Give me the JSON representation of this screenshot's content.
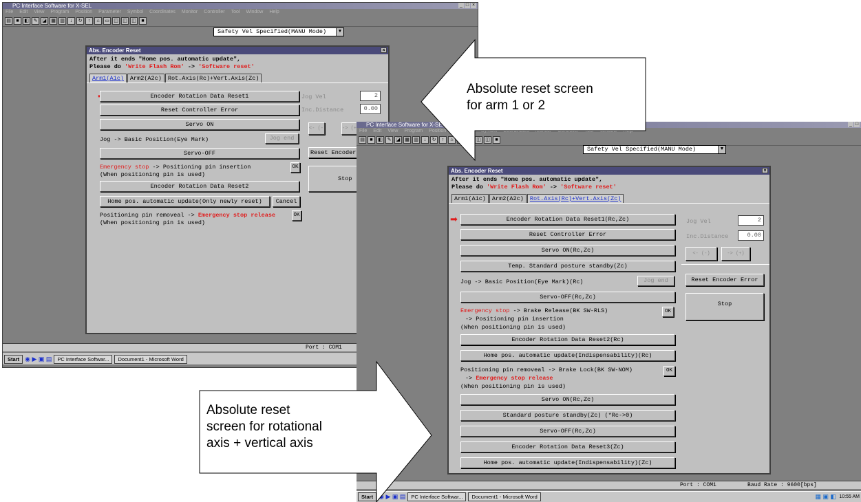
{
  "window1": {
    "title": "PC Interface Software for X-SEL",
    "menu": [
      "File",
      "Edit",
      "View",
      "Program",
      "Position",
      "Parameter",
      "Symbol",
      "Coordinates",
      "Monitor",
      "Controller",
      "Tool",
      "Window",
      "Help"
    ],
    "mode_select": "Safety Vel Specified(MANU Mode)",
    "status_port": "Port : COM1",
    "taskbar": {
      "start": "Start",
      "task1": "PC Interface Softwar...",
      "task2": "Document1 - Microsoft Word"
    }
  },
  "dialog1": {
    "title": "Abs. Encoder Reset",
    "note_line1": "After it ends \"Home pos. automatic update\",",
    "note_line2_prefix": "Please do ",
    "note_line2_red1": "'Write Flash Rom'",
    "note_line2_mid": " -> ",
    "note_line2_red2": "'Software reset'",
    "tabs": [
      "Arm1(A1c)",
      "Arm2(A2c)",
      "Rot.Axis(Rc)+Vert.Axis(Zc)"
    ],
    "enc_reset1": "Encoder Rotation Data Reset1",
    "reset_ctrl_err": "Reset Controller Error",
    "servo_on": "Servo ON",
    "jog_basic": "Jog -> Basic Position(Eye Mark)",
    "jog_end": "Jog end",
    "servo_off": "Servo-OFF",
    "estop_red": "Emergency stop",
    "estop_rest": " -> Positioning pin insertion",
    "when_used": "(When positioning pin is used)",
    "ok": "OK",
    "enc_reset2": "Encoder Rotation Data Reset2",
    "home_update": "Home pos. automatic update(Only newly reset)",
    "cancel": "Cancel",
    "pin_removal": "Positioning pin removeal -> ",
    "estop_release": "Emergency stop release",
    "when_used2": "(When positioning pin is used)",
    "jog_vel_label": "Jog Vel",
    "jog_vel_value": "2",
    "inc_dist_label": "Inc.Distance",
    "inc_dist_value": "0.00",
    "jog_minus": "<- (-)",
    "jog_plus": "-> (+)",
    "reset_encoder_error": "Reset Encoder Error",
    "stop": "Stop"
  },
  "window2": {
    "title": "PC Interface Software for X-SEL",
    "menu": [
      "File",
      "Edit",
      "View",
      "Program",
      "Position",
      "Parameter",
      "Symbol",
      "Coordinates",
      "Monitor",
      "Controller",
      "Tool",
      "Window",
      "Help"
    ],
    "mode_select": "Safety Vel Specified(MANU Mode)",
    "status_port": "Port : COM1",
    "status_baud": "Baud Rate : 9600[bps]",
    "taskbar": {
      "start": "Start",
      "task1": "PC Interface Softwar...",
      "task2": "Document1 - Microsoft Word",
      "clock": "10:55 AM"
    }
  },
  "dialog2": {
    "title": "Abs. Encoder Reset",
    "note_line1": "After it ends \"Home pos. automatic update\",",
    "note_line2_prefix": "Please do ",
    "note_line2_red1": "'Write Flash Rom'",
    "note_line2_mid": " -> ",
    "note_line2_red2": "'Software reset'",
    "tabs": [
      "Arm1(A1c)",
      "Arm2(A2c)",
      "Rot.Axis(Rc)+Vert.Axis(Zc)"
    ],
    "enc_reset1": "Encoder Rotation Data Reset1(Rc,Zc)",
    "reset_ctrl_err": "Reset Controller Error",
    "servo_on": "Servo ON(Rc,Zc)",
    "temp_standby": "Temp. Standard posture standby(Zc)",
    "jog_basic": "Jog -> Basic Position(Eye Mark)(Rc)",
    "jog_end": "Jog end",
    "servo_off": "Servo-OFF(Rc,Zc)",
    "estop_red": "Emergency stop",
    "estop_rest": " -> Brake Release(BK SW-RLS)",
    "pin_insert": "-> Positioning pin insertion",
    "when_used": "(When positioning pin is used)",
    "ok": "OK",
    "enc_reset2": "Encoder Rotation Data Reset2(Rc)",
    "home_update": "Home pos. automatic update(Indispensability)(Rc)",
    "pin_removal": "Positioning pin removeal -> Brake Lock(BK SW-NOM)",
    "estop_release_prefix": "-> ",
    "estop_release": "Emergency stop release",
    "when_used2": "(When positioning pin is used)",
    "servo_on2": "Servo ON(Rc,Zc)",
    "std_standby": "Standard posture standby(Zc)  (*Rc->0)",
    "servo_off2": "Servo-OFF(Rc,Zc)",
    "enc_reset3": "Encoder Rotation Data Reset3(Zc)",
    "home_update2": "Home pos. automatic update(Indispensability)(Zc)",
    "jog_vel_label": "Jog Vel",
    "jog_vel_value": "2",
    "inc_dist_label": "Inc.Distance",
    "inc_dist_value": "0.00",
    "jog_minus": "<- (-)",
    "jog_plus": "-> (+)",
    "reset_encoder_error": "Reset Encoder Error",
    "stop": "Stop"
  },
  "callouts": {
    "arm": [
      "Absolute reset screen",
      "for arm 1 or 2"
    ],
    "rot": [
      "Absolute reset",
      "screen for rotational",
      "axis + vertical axis"
    ]
  }
}
